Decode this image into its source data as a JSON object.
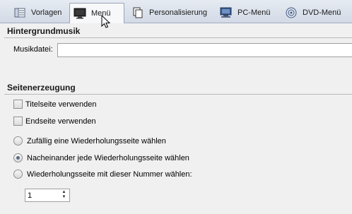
{
  "tabs": [
    {
      "label": "Vorlagen",
      "icon": "template-icon",
      "active": false
    },
    {
      "label": "Menü",
      "icon": "monitor-icon",
      "active": true
    },
    {
      "label": "Personalisierung",
      "icon": "copy-pages-icon",
      "active": false
    },
    {
      "label": "PC-Menü",
      "icon": "pc-monitor-icon",
      "active": false
    },
    {
      "label": "DVD-Menü",
      "icon": "dvd-disc-icon",
      "active": false
    }
  ],
  "music": {
    "title": "Hintergrundmusik",
    "file_label": "Musikdatei:",
    "file_value": ""
  },
  "pages": {
    "title": "Seitenerzeugung",
    "title_page_label": "Titelseite verwenden",
    "end_page_label": "Endseite verwenden",
    "random_label": "Zufällig eine Wiederholungsseite wählen",
    "sequential_label": "Nacheinander jede Wiederholungsseite wählen",
    "number_label": "Wiederholungsseite mit dieser Nummer wählen:",
    "number_value": "1",
    "selected_option": "sequential"
  }
}
